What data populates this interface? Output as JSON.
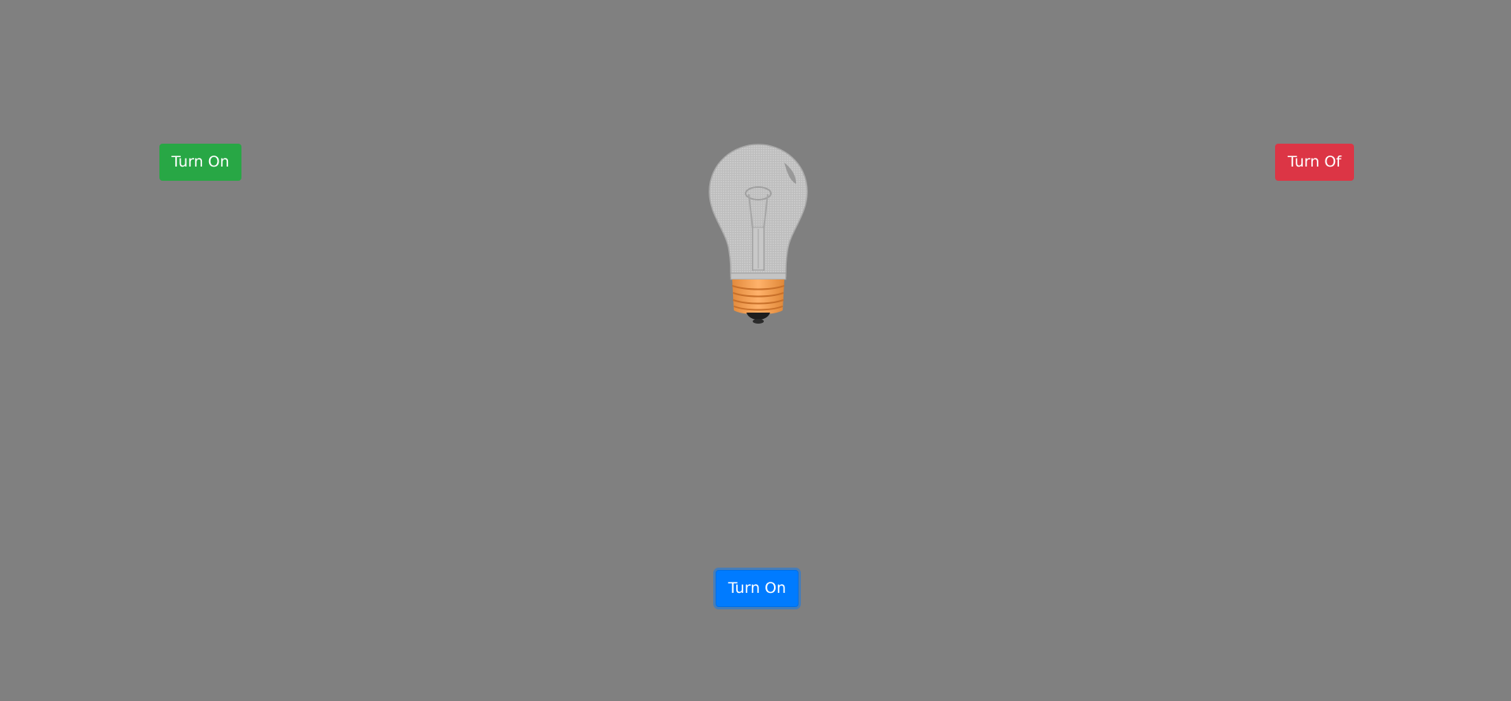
{
  "buttons": {
    "left_on_label": "Turn On",
    "right_off_label": "Turn Of",
    "bottom_on_label": "Turn On"
  },
  "bulb": {
    "state": "off",
    "icon": "lightbulb-icon"
  },
  "colors": {
    "background": "#808080",
    "on_green": "#28a745",
    "off_red": "#dc3545",
    "primary_blue": "#007bff",
    "bulb_base": "#f4a460"
  }
}
